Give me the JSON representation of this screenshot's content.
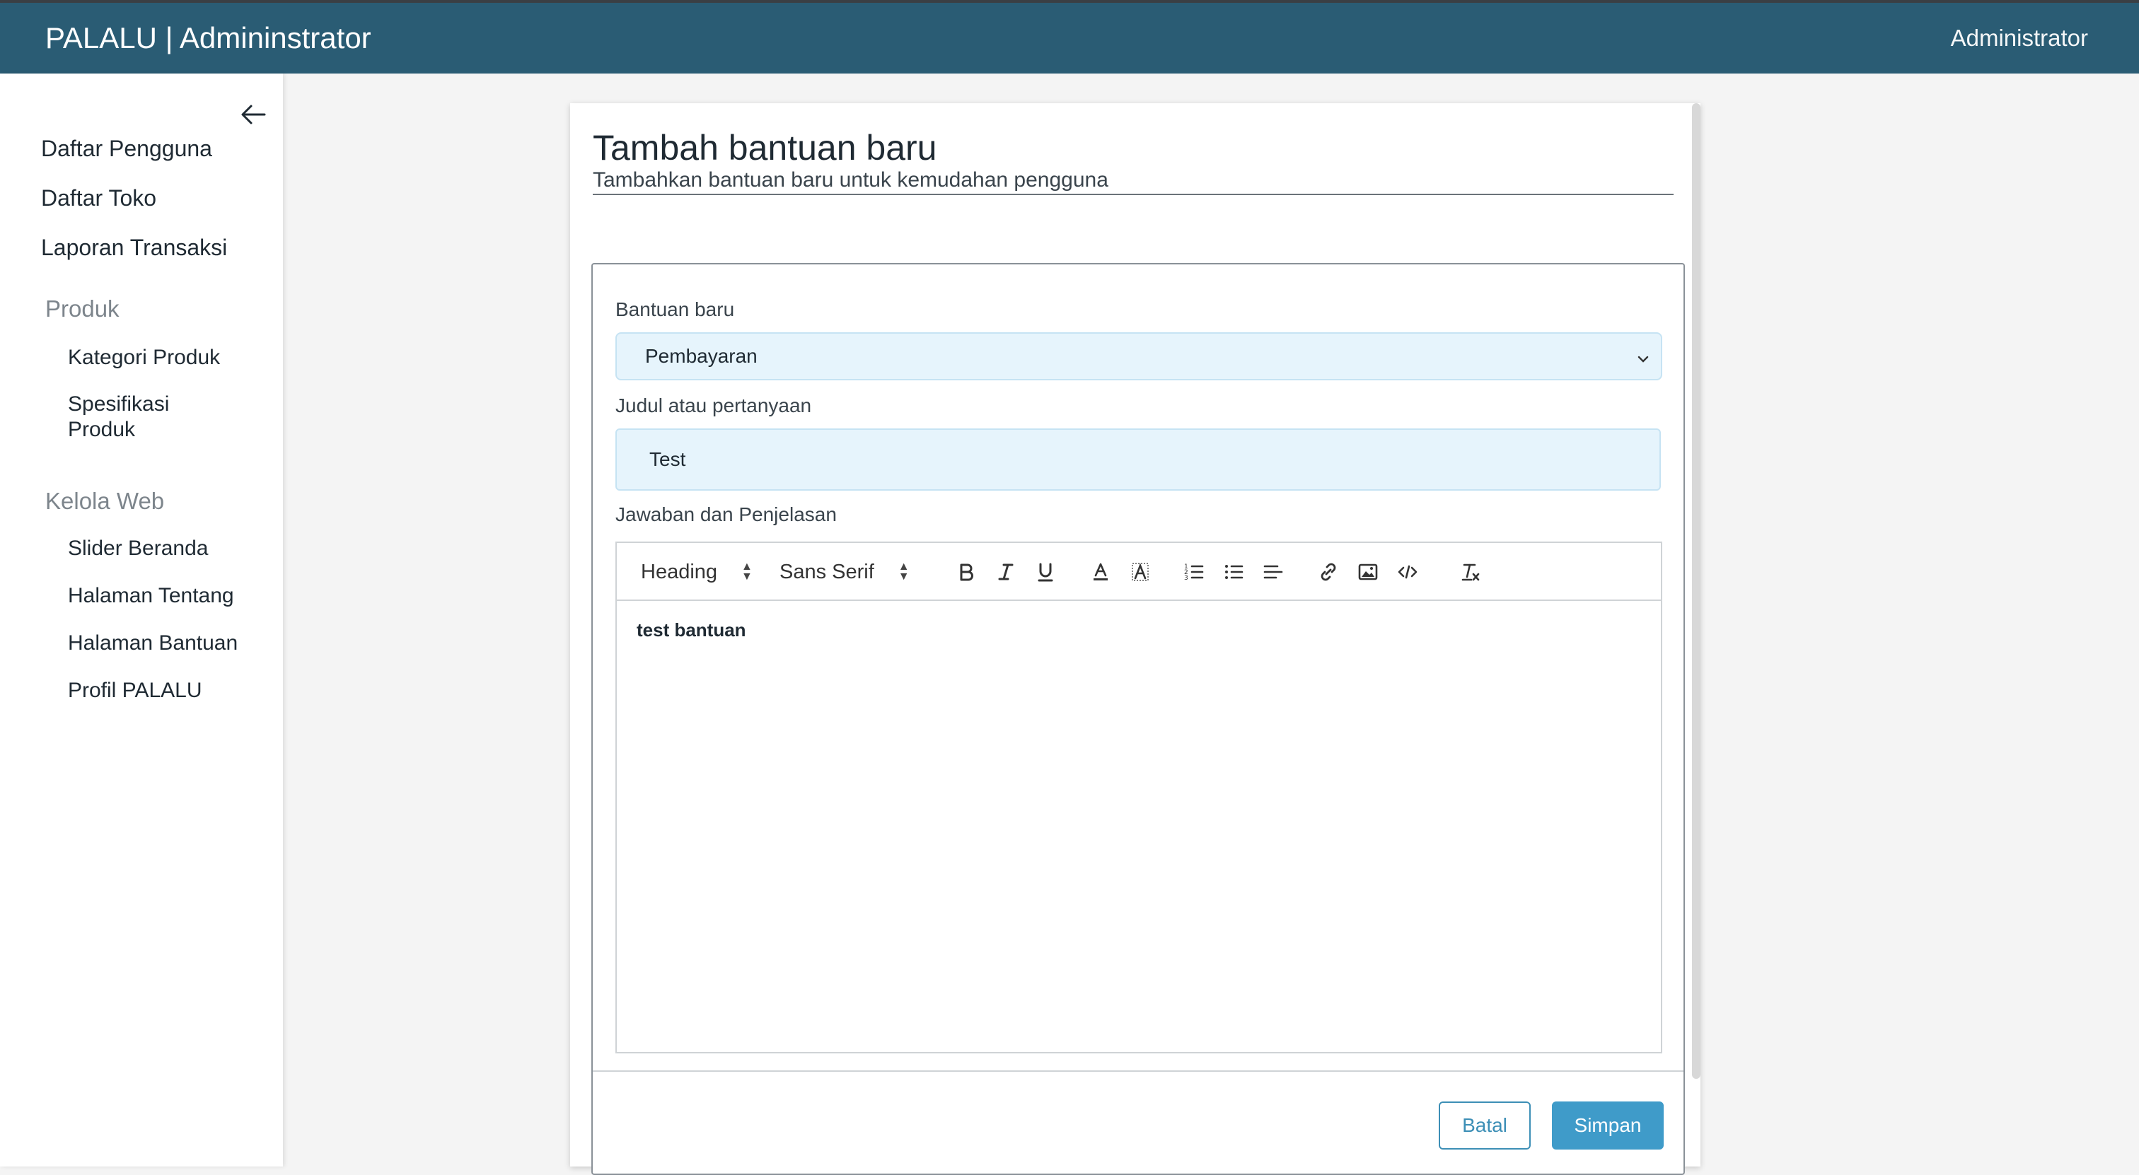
{
  "header": {
    "brand": "PALALU | Admininstrator",
    "user": "Administrator"
  },
  "sidebar": {
    "collapse_icon": "arrow-left-icon",
    "items": [
      {
        "label": "Daftar Pengguna"
      },
      {
        "label": "Daftar Toko"
      },
      {
        "label": "Laporan Transaksi"
      }
    ],
    "groups": [
      {
        "label": "Produk",
        "items": [
          {
            "label": "Kategori Produk"
          },
          {
            "label": "Spesifikasi Produk"
          }
        ]
      },
      {
        "label": "Kelola Web",
        "items": [
          {
            "label": "Slider Beranda"
          },
          {
            "label": "Halaman Tentang"
          },
          {
            "label": "Halaman Bantuan"
          },
          {
            "label": "Profil PALALU"
          }
        ]
      }
    ]
  },
  "page": {
    "title": "Tambah bantuan baru",
    "subtitle": "Tambahkan bantuan baru untuk kemudahan pengguna"
  },
  "form": {
    "category": {
      "label": "Bantuan baru",
      "selected": "Pembayaran"
    },
    "question": {
      "label": "Judul atau pertanyaan",
      "value": "Test"
    },
    "answer": {
      "label": "Jawaban dan Penjelasan",
      "toolbar": {
        "heading_picker": "Heading",
        "font_picker": "Sans Serif",
        "icons": [
          "bold-icon",
          "italic-icon",
          "underline-icon",
          "text-color-icon",
          "background-color-icon",
          "ordered-list-icon",
          "bullet-list-icon",
          "align-left-icon",
          "link-icon",
          "image-icon",
          "code-icon",
          "clear-format-icon"
        ]
      },
      "content": "test bantuan"
    },
    "buttons": {
      "cancel": "Batal",
      "save": "Simpan"
    }
  },
  "colors": {
    "topbar": "#2a5c74",
    "input_bg": "#e6f4fc",
    "primary_button": "#3f9bc9",
    "outline_button": "#3d8fb6"
  }
}
